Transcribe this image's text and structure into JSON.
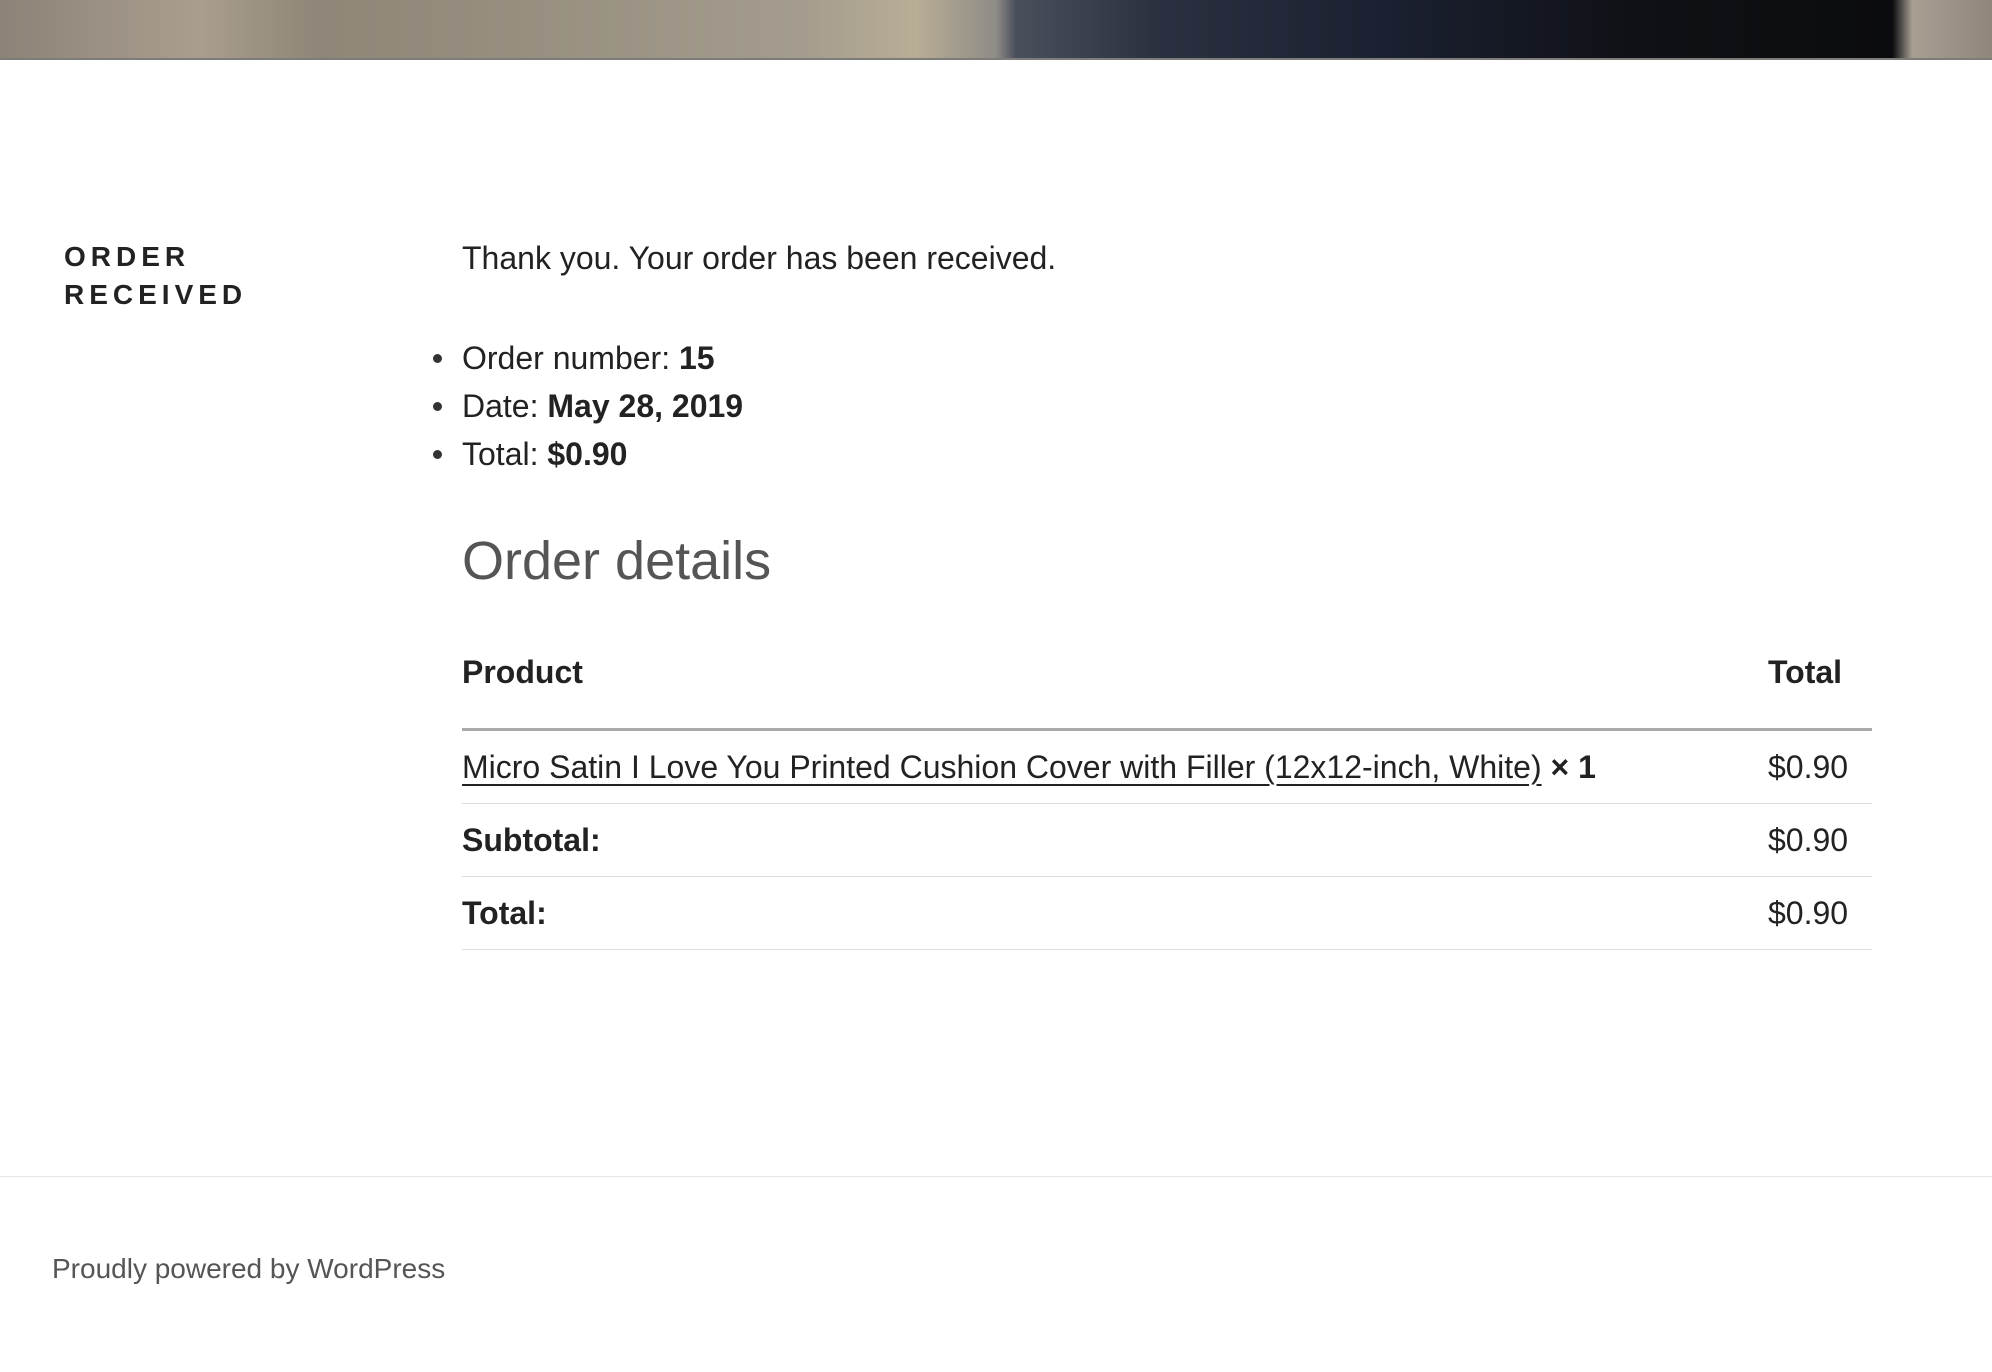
{
  "entry_title": {
    "line1": "ORDER",
    "line2": "RECEIVED"
  },
  "notice": "Thank you. Your order has been received.",
  "overview": {
    "order_number_label": "Order number: ",
    "order_number": "15",
    "date_label": "Date: ",
    "date": "May 28, 2019",
    "total_label": "Total: ",
    "total": "$0.90"
  },
  "order_details": {
    "heading": "Order details",
    "columns": [
      "Product",
      "Total"
    ],
    "items": [
      {
        "product": "Micro Satin I Love You Printed Cushion Cover with Filler (12x12-inch, White)",
        "quantity": "× 1",
        "total": "$0.90"
      }
    ],
    "subtotal_label": "Subtotal:",
    "subtotal": "$0.90",
    "total_label": "Total:",
    "total": "$0.90"
  },
  "footer": {
    "powered_by": "Proudly powered by WordPress"
  }
}
